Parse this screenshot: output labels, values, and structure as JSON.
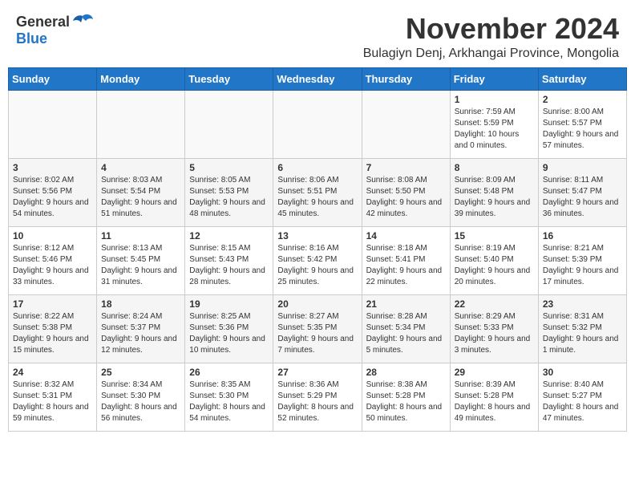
{
  "header": {
    "logo": {
      "general": "General",
      "blue": "Blue"
    },
    "title": "November 2024",
    "location": "Bulagiyn Denj, Arkhangai Province, Mongolia"
  },
  "days_of_week": [
    "Sunday",
    "Monday",
    "Tuesday",
    "Wednesday",
    "Thursday",
    "Friday",
    "Saturday"
  ],
  "weeks": [
    [
      {
        "day": "",
        "sunrise": "",
        "sunset": "",
        "daylight": "",
        "empty": true
      },
      {
        "day": "",
        "sunrise": "",
        "sunset": "",
        "daylight": "",
        "empty": true
      },
      {
        "day": "",
        "sunrise": "",
        "sunset": "",
        "daylight": "",
        "empty": true
      },
      {
        "day": "",
        "sunrise": "",
        "sunset": "",
        "daylight": "",
        "empty": true
      },
      {
        "day": "",
        "sunrise": "",
        "sunset": "",
        "daylight": "",
        "empty": true
      },
      {
        "day": "1",
        "sunrise": "Sunrise: 7:59 AM",
        "sunset": "Sunset: 5:59 PM",
        "daylight": "Daylight: 10 hours and 0 minutes.",
        "empty": false
      },
      {
        "day": "2",
        "sunrise": "Sunrise: 8:00 AM",
        "sunset": "Sunset: 5:57 PM",
        "daylight": "Daylight: 9 hours and 57 minutes.",
        "empty": false
      }
    ],
    [
      {
        "day": "3",
        "sunrise": "Sunrise: 8:02 AM",
        "sunset": "Sunset: 5:56 PM",
        "daylight": "Daylight: 9 hours and 54 minutes.",
        "empty": false
      },
      {
        "day": "4",
        "sunrise": "Sunrise: 8:03 AM",
        "sunset": "Sunset: 5:54 PM",
        "daylight": "Daylight: 9 hours and 51 minutes.",
        "empty": false
      },
      {
        "day": "5",
        "sunrise": "Sunrise: 8:05 AM",
        "sunset": "Sunset: 5:53 PM",
        "daylight": "Daylight: 9 hours and 48 minutes.",
        "empty": false
      },
      {
        "day": "6",
        "sunrise": "Sunrise: 8:06 AM",
        "sunset": "Sunset: 5:51 PM",
        "daylight": "Daylight: 9 hours and 45 minutes.",
        "empty": false
      },
      {
        "day": "7",
        "sunrise": "Sunrise: 8:08 AM",
        "sunset": "Sunset: 5:50 PM",
        "daylight": "Daylight: 9 hours and 42 minutes.",
        "empty": false
      },
      {
        "day": "8",
        "sunrise": "Sunrise: 8:09 AM",
        "sunset": "Sunset: 5:48 PM",
        "daylight": "Daylight: 9 hours and 39 minutes.",
        "empty": false
      },
      {
        "day": "9",
        "sunrise": "Sunrise: 8:11 AM",
        "sunset": "Sunset: 5:47 PM",
        "daylight": "Daylight: 9 hours and 36 minutes.",
        "empty": false
      }
    ],
    [
      {
        "day": "10",
        "sunrise": "Sunrise: 8:12 AM",
        "sunset": "Sunset: 5:46 PM",
        "daylight": "Daylight: 9 hours and 33 minutes.",
        "empty": false
      },
      {
        "day": "11",
        "sunrise": "Sunrise: 8:13 AM",
        "sunset": "Sunset: 5:45 PM",
        "daylight": "Daylight: 9 hours and 31 minutes.",
        "empty": false
      },
      {
        "day": "12",
        "sunrise": "Sunrise: 8:15 AM",
        "sunset": "Sunset: 5:43 PM",
        "daylight": "Daylight: 9 hours and 28 minutes.",
        "empty": false
      },
      {
        "day": "13",
        "sunrise": "Sunrise: 8:16 AM",
        "sunset": "Sunset: 5:42 PM",
        "daylight": "Daylight: 9 hours and 25 minutes.",
        "empty": false
      },
      {
        "day": "14",
        "sunrise": "Sunrise: 8:18 AM",
        "sunset": "Sunset: 5:41 PM",
        "daylight": "Daylight: 9 hours and 22 minutes.",
        "empty": false
      },
      {
        "day": "15",
        "sunrise": "Sunrise: 8:19 AM",
        "sunset": "Sunset: 5:40 PM",
        "daylight": "Daylight: 9 hours and 20 minutes.",
        "empty": false
      },
      {
        "day": "16",
        "sunrise": "Sunrise: 8:21 AM",
        "sunset": "Sunset: 5:39 PM",
        "daylight": "Daylight: 9 hours and 17 minutes.",
        "empty": false
      }
    ],
    [
      {
        "day": "17",
        "sunrise": "Sunrise: 8:22 AM",
        "sunset": "Sunset: 5:38 PM",
        "daylight": "Daylight: 9 hours and 15 minutes.",
        "empty": false
      },
      {
        "day": "18",
        "sunrise": "Sunrise: 8:24 AM",
        "sunset": "Sunset: 5:37 PM",
        "daylight": "Daylight: 9 hours and 12 minutes.",
        "empty": false
      },
      {
        "day": "19",
        "sunrise": "Sunrise: 8:25 AM",
        "sunset": "Sunset: 5:36 PM",
        "daylight": "Daylight: 9 hours and 10 minutes.",
        "empty": false
      },
      {
        "day": "20",
        "sunrise": "Sunrise: 8:27 AM",
        "sunset": "Sunset: 5:35 PM",
        "daylight": "Daylight: 9 hours and 7 minutes.",
        "empty": false
      },
      {
        "day": "21",
        "sunrise": "Sunrise: 8:28 AM",
        "sunset": "Sunset: 5:34 PM",
        "daylight": "Daylight: 9 hours and 5 minutes.",
        "empty": false
      },
      {
        "day": "22",
        "sunrise": "Sunrise: 8:29 AM",
        "sunset": "Sunset: 5:33 PM",
        "daylight": "Daylight: 9 hours and 3 minutes.",
        "empty": false
      },
      {
        "day": "23",
        "sunrise": "Sunrise: 8:31 AM",
        "sunset": "Sunset: 5:32 PM",
        "daylight": "Daylight: 9 hours and 1 minute.",
        "empty": false
      }
    ],
    [
      {
        "day": "24",
        "sunrise": "Sunrise: 8:32 AM",
        "sunset": "Sunset: 5:31 PM",
        "daylight": "Daylight: 8 hours and 59 minutes.",
        "empty": false
      },
      {
        "day": "25",
        "sunrise": "Sunrise: 8:34 AM",
        "sunset": "Sunset: 5:30 PM",
        "daylight": "Daylight: 8 hours and 56 minutes.",
        "empty": false
      },
      {
        "day": "26",
        "sunrise": "Sunrise: 8:35 AM",
        "sunset": "Sunset: 5:30 PM",
        "daylight": "Daylight: 8 hours and 54 minutes.",
        "empty": false
      },
      {
        "day": "27",
        "sunrise": "Sunrise: 8:36 AM",
        "sunset": "Sunset: 5:29 PM",
        "daylight": "Daylight: 8 hours and 52 minutes.",
        "empty": false
      },
      {
        "day": "28",
        "sunrise": "Sunrise: 8:38 AM",
        "sunset": "Sunset: 5:28 PM",
        "daylight": "Daylight: 8 hours and 50 minutes.",
        "empty": false
      },
      {
        "day": "29",
        "sunrise": "Sunrise: 8:39 AM",
        "sunset": "Sunset: 5:28 PM",
        "daylight": "Daylight: 8 hours and 49 minutes.",
        "empty": false
      },
      {
        "day": "30",
        "sunrise": "Sunrise: 8:40 AM",
        "sunset": "Sunset: 5:27 PM",
        "daylight": "Daylight: 8 hours and 47 minutes.",
        "empty": false
      }
    ]
  ]
}
